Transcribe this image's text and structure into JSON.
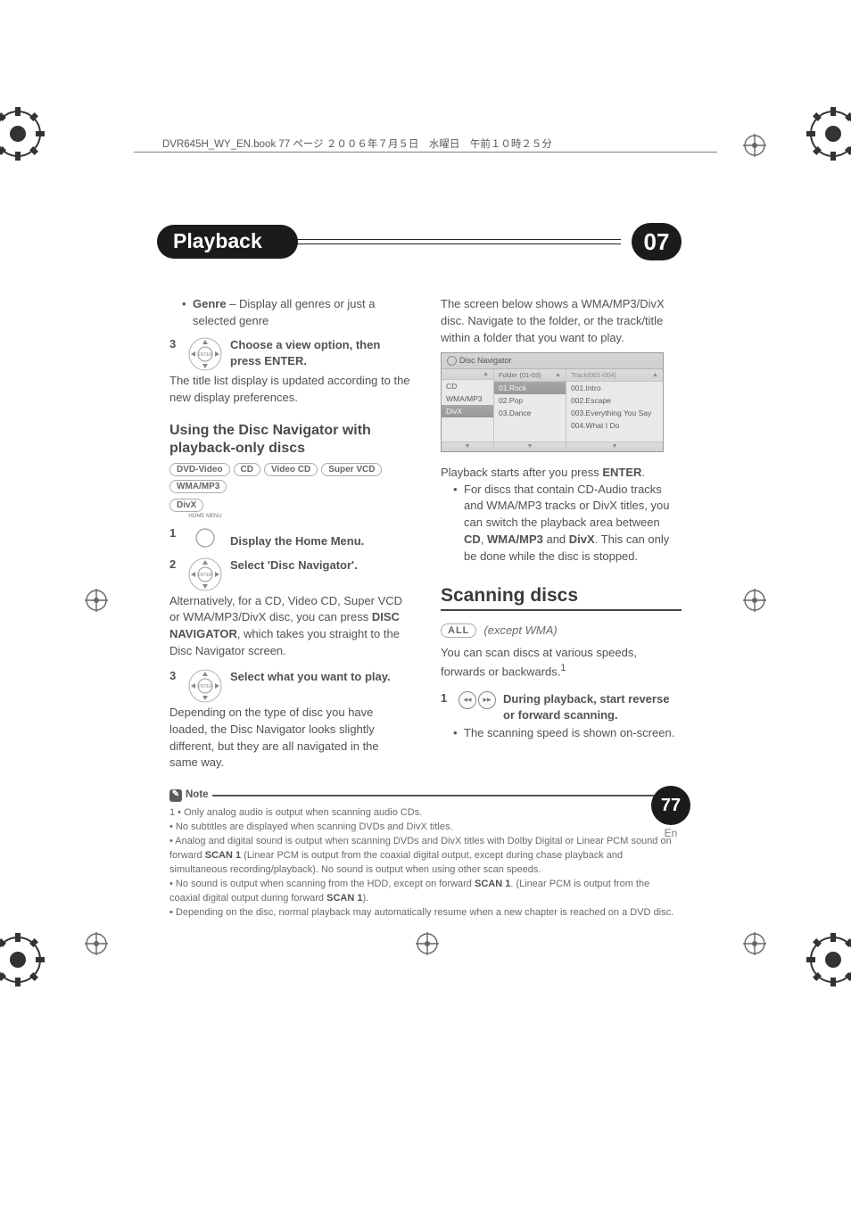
{
  "meta": {
    "top_line": "DVR645H_WY_EN.book  77 ページ  ２００６年７月５日　水曜日　午前１０時２５分"
  },
  "header": {
    "title": "Playback",
    "chapter": "07"
  },
  "left": {
    "bullet_genre_b": "Genre",
    "bullet_genre_rest": " – Display all genres or just a selected genre",
    "step3_text": "Choose a view option, then press ENTER.",
    "step3_after": "The title list display is updated according to the new display preferences.",
    "sub_heading": "Using the Disc Navigator with playback-only discs",
    "tags": [
      "DVD-Video",
      "CD",
      "Video CD",
      "Super VCD",
      "WMA/MP3",
      "DivX"
    ],
    "step1_label_small": "HOME MENU",
    "step1_text": "Display the Home Menu.",
    "step2_text": "Select 'Disc Navigator'.",
    "step2_after_a": "Alternatively, for a CD, Video CD, Super VCD or WMA/MP3/DivX disc, you can press ",
    "step2_after_b": "DISC NAVIGATOR",
    "step2_after_c": ", which takes you straight to the Disc Navigator screen.",
    "step3b_text": "Select what you want to play.",
    "step3b_after": "Depending on the type of disc you have loaded, the Disc Navigator looks slightly different, but they are all navigated in the same way."
  },
  "right": {
    "intro": "The screen below shows a WMA/MP3/DivX disc. Navigate to the folder, or the track/title within a folder that you want to play.",
    "nav": {
      "title": "Disc Navigator",
      "col1": [
        "CD",
        "WMA/MP3",
        "DivX"
      ],
      "col2_head": "Folder (01-03)",
      "col2": [
        "01.Rock",
        "02.Pop",
        "03.Dance"
      ],
      "col3_head": "Track(001-004)",
      "col3": [
        "001.Intro",
        "002.Escape",
        "003.Everything You Say",
        "004.What I Do"
      ]
    },
    "after_shot_a": "Playback starts after you press ",
    "after_shot_b": "ENTER",
    "after_shot_c": ".",
    "bullet_a": "For discs that contain CD-Audio tracks and WMA/MP3 tracks or DivX titles, you can switch the playback area between ",
    "bullet_b": "CD",
    "bullet_c": ", ",
    "bullet_d": "WMA/MP3",
    "bullet_e": " and ",
    "bullet_f": "DivX",
    "bullet_g": ". This can only be done while the disc is stopped.",
    "section_heading": "Scanning discs",
    "tag_all": "ALL",
    "except": "(except WMA)",
    "scan_para_a": "You can scan discs at various speeds, forwards or backwards.",
    "scan_sup": "1",
    "scan_step1": "During playback, start reverse or forward scanning.",
    "scan_bullet": "The scanning speed is shown on-screen."
  },
  "note": {
    "label": "Note",
    "n1": "1 • Only analog audio is output when scanning audio CDs.",
    "n2": "• No subtitles are displayed when scanning DVDs and DivX titles.",
    "n3a": "• Analog and digital sound is output when scanning DVDs and DivX titles with Dolby Digital or Linear PCM sound on forward ",
    "n3b": "SCAN 1",
    "n3c": " (Linear PCM is output from the coaxial digital output, except during chase playback and simultaneous recording/playback). No sound is output when using other scan speeds.",
    "n4a": "• No sound is output when scanning from the HDD, except on forward ",
    "n4b": "SCAN 1",
    "n4c": ". (Linear PCM is output from the coaxial digital output during forward ",
    "n4d": "SCAN 1",
    "n4e": ").",
    "n5": "• Depending on the disc, normal playback may automatically resume when a new chapter is reached on a DVD disc."
  },
  "pagenum": {
    "num": "77",
    "lang": "En"
  }
}
